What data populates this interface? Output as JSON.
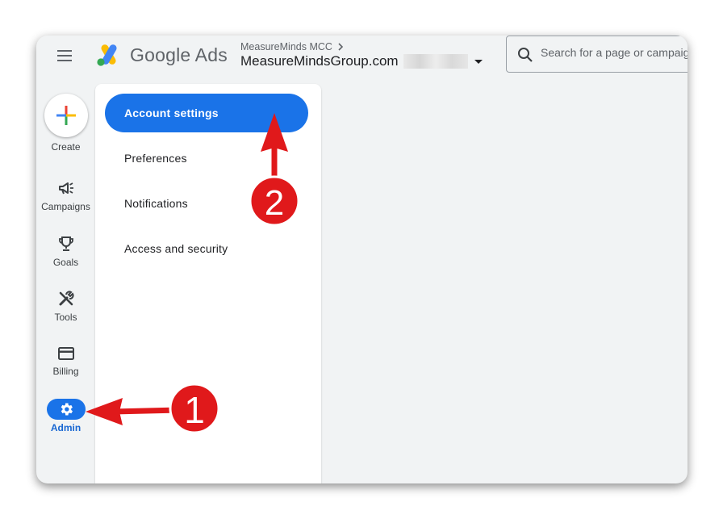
{
  "header": {
    "product_name": "Google Ads",
    "manager_account": "MeasureMinds MCC",
    "account_name": "MeasureMindsGroup.com",
    "search_placeholder": "Search for a page or campaign"
  },
  "rail": {
    "items": [
      {
        "label": "Create",
        "icon": "plus-icon"
      },
      {
        "label": "Campaigns",
        "icon": "megaphone-icon"
      },
      {
        "label": "Goals",
        "icon": "trophy-icon"
      },
      {
        "label": "Tools",
        "icon": "tools-icon"
      },
      {
        "label": "Billing",
        "icon": "credit-card-icon"
      },
      {
        "label": "Admin",
        "icon": "gear-icon",
        "selected": true
      }
    ]
  },
  "admin_menu": {
    "items": [
      {
        "label": "Account settings",
        "selected": true
      },
      {
        "label": "Preferences"
      },
      {
        "label": "Notifications"
      },
      {
        "label": "Access and security"
      }
    ]
  },
  "annotations": {
    "markers": [
      {
        "number": "1",
        "points_to": "Admin"
      },
      {
        "number": "2",
        "points_to": "Account settings"
      }
    ],
    "color": "#e0191b"
  },
  "colors": {
    "accent": "#1a73e8",
    "background": "#f1f3f4"
  }
}
